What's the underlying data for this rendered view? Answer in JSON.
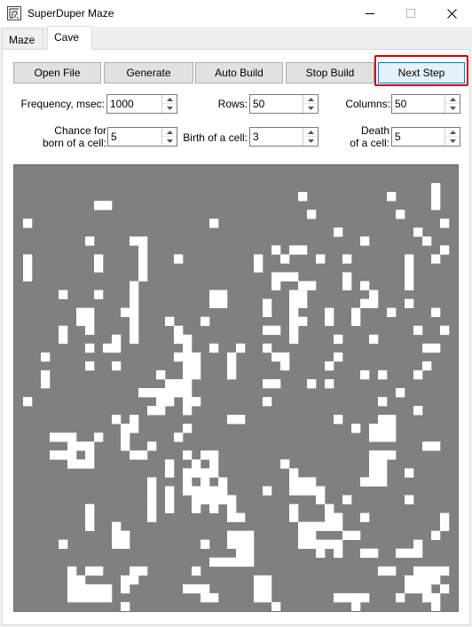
{
  "window": {
    "title": "SuperDuper Maze"
  },
  "tabs": [
    {
      "label": "Maze",
      "active": false
    },
    {
      "label": "Cave",
      "active": true
    }
  ],
  "toolbar": {
    "open_file": "Open File",
    "generate": "Generate",
    "auto_build": "Auto Build",
    "stop_build": "Stop Build",
    "next_step": "Next Step"
  },
  "settings": {
    "frequency": {
      "label": "Frequency, msec:",
      "value": "1000"
    },
    "rows": {
      "label": "Rows:",
      "value": "50"
    },
    "columns": {
      "label": "Columns:",
      "value": "50"
    },
    "chance": {
      "label_line1": "Chance for",
      "label_line2": "born of a cell:",
      "value": "5"
    },
    "birth": {
      "label": "Birth of a cell:",
      "value": "3"
    },
    "death": {
      "label_line1": "Death",
      "label_line2": "of a cell:",
      "value": "5"
    }
  },
  "icons": {
    "app": "maze-icon",
    "minimize": "minimize-icon",
    "maximize": "maximize-icon",
    "close": "close-icon",
    "spin_up": "chevron-up-icon",
    "spin_down": "chevron-down-icon"
  },
  "colors": {
    "wall": "#808080",
    "cell": "#ffffff",
    "highlight": "#d60000",
    "accent": "#0078d7"
  },
  "cave_grid": {
    "rows": 50,
    "columns": 50,
    "cells": [
      [
        2,
        47
      ],
      [
        3,
        32
      ],
      [
        3,
        42
      ],
      [
        3,
        47
      ],
      [
        4,
        9
      ],
      [
        4,
        10
      ],
      [
        4,
        47
      ],
      [
        5,
        33
      ],
      [
        5,
        43
      ],
      [
        6,
        1
      ],
      [
        6,
        22
      ],
      [
        6,
        48
      ],
      [
        7,
        36
      ],
      [
        7,
        45
      ],
      [
        8,
        8
      ],
      [
        8,
        13
      ],
      [
        8,
        14
      ],
      [
        8,
        39
      ],
      [
        8,
        46
      ],
      [
        9,
        14
      ],
      [
        9,
        29
      ],
      [
        9,
        31
      ],
      [
        9,
        32
      ],
      [
        9,
        48
      ],
      [
        10,
        1
      ],
      [
        10,
        9
      ],
      [
        10,
        14
      ],
      [
        10,
        18
      ],
      [
        10,
        27
      ],
      [
        10,
        30
      ],
      [
        10,
        34
      ],
      [
        10,
        37
      ],
      [
        10,
        44
      ],
      [
        10,
        47
      ],
      [
        11,
        1
      ],
      [
        11,
        9
      ],
      [
        11,
        14
      ],
      [
        11,
        27
      ],
      [
        11,
        44
      ],
      [
        12,
        1
      ],
      [
        12,
        14
      ],
      [
        12,
        29
      ],
      [
        12,
        30
      ],
      [
        12,
        31
      ],
      [
        12,
        37
      ],
      [
        12,
        44
      ],
      [
        13,
        13
      ],
      [
        13,
        29
      ],
      [
        13,
        32
      ],
      [
        13,
        33
      ],
      [
        13,
        37
      ],
      [
        13,
        39
      ],
      [
        13,
        44
      ],
      [
        14,
        5
      ],
      [
        14,
        9
      ],
      [
        14,
        13
      ],
      [
        14,
        22
      ],
      [
        14,
        23
      ],
      [
        14,
        31
      ],
      [
        14,
        32
      ],
      [
        14,
        40
      ],
      [
        15,
        13
      ],
      [
        15,
        22
      ],
      [
        15,
        23
      ],
      [
        15,
        28
      ],
      [
        15,
        31
      ],
      [
        15,
        32
      ],
      [
        15,
        39
      ],
      [
        15,
        40
      ],
      [
        15,
        44
      ],
      [
        16,
        7
      ],
      [
        16,
        8
      ],
      [
        16,
        12
      ],
      [
        16,
        13
      ],
      [
        16,
        28
      ],
      [
        16,
        31
      ],
      [
        16,
        35
      ],
      [
        16,
        38
      ],
      [
        16,
        42
      ],
      [
        16,
        47
      ],
      [
        17,
        7
      ],
      [
        17,
        8
      ],
      [
        17,
        13
      ],
      [
        17,
        17
      ],
      [
        17,
        21
      ],
      [
        17,
        31
      ],
      [
        17,
        32
      ],
      [
        17,
        35
      ],
      [
        17,
        38
      ],
      [
        18,
        8
      ],
      [
        18,
        5
      ],
      [
        18,
        13
      ],
      [
        18,
        18
      ],
      [
        18,
        28
      ],
      [
        18,
        29
      ],
      [
        18,
        31
      ],
      [
        18,
        48
      ],
      [
        18,
        45
      ],
      [
        19,
        5
      ],
      [
        19,
        11
      ],
      [
        19,
        13
      ],
      [
        19,
        18
      ],
      [
        19,
        19
      ],
      [
        19,
        31
      ],
      [
        19,
        36
      ],
      [
        19,
        40
      ],
      [
        20,
        8
      ],
      [
        20,
        10
      ],
      [
        20,
        11
      ],
      [
        20,
        19
      ],
      [
        20,
        22
      ],
      [
        20,
        25
      ],
      [
        20,
        28
      ],
      [
        20,
        46
      ],
      [
        20,
        47
      ],
      [
        21,
        3
      ],
      [
        21,
        18
      ],
      [
        21,
        19
      ],
      [
        21,
        20
      ],
      [
        21,
        24
      ],
      [
        21,
        29
      ],
      [
        21,
        30
      ],
      [
        21,
        36
      ],
      [
        22,
        8
      ],
      [
        22,
        11
      ],
      [
        22,
        19
      ],
      [
        22,
        20
      ],
      [
        22,
        24
      ],
      [
        22,
        35
      ],
      [
        22,
        30
      ],
      [
        22,
        46
      ],
      [
        23,
        3
      ],
      [
        23,
        16
      ],
      [
        23,
        19
      ],
      [
        23,
        20
      ],
      [
        23,
        24
      ],
      [
        23,
        39
      ],
      [
        23,
        41
      ],
      [
        23,
        45
      ],
      [
        24,
        3
      ],
      [
        24,
        17
      ],
      [
        24,
        18
      ],
      [
        24,
        19
      ],
      [
        24,
        28
      ],
      [
        24,
        29
      ],
      [
        24,
        33
      ],
      [
        24,
        35
      ],
      [
        25,
        14
      ],
      [
        25,
        15
      ],
      [
        25,
        16
      ],
      [
        25,
        17
      ],
      [
        25,
        18
      ],
      [
        25,
        19
      ],
      [
        25,
        43
      ],
      [
        26,
        1
      ],
      [
        26,
        16
      ],
      [
        26,
        17
      ],
      [
        26,
        19
      ],
      [
        26,
        20
      ],
      [
        26,
        28
      ],
      [
        26,
        41
      ],
      [
        27,
        15
      ],
      [
        27,
        16
      ],
      [
        27,
        19
      ],
      [
        27,
        45
      ],
      [
        28,
        11
      ],
      [
        28,
        13
      ],
      [
        28,
        24
      ],
      [
        28,
        25
      ],
      [
        28,
        36
      ],
      [
        28,
        41
      ],
      [
        28,
        42
      ],
      [
        29,
        12
      ],
      [
        29,
        13
      ],
      [
        29,
        19
      ],
      [
        29,
        38
      ],
      [
        29,
        40
      ],
      [
        29,
        41
      ],
      [
        29,
        42
      ],
      [
        30,
        4
      ],
      [
        30,
        5
      ],
      [
        30,
        6
      ],
      [
        30,
        9
      ],
      [
        30,
        12
      ],
      [
        30,
        18
      ],
      [
        30,
        40
      ],
      [
        30,
        41
      ],
      [
        30,
        42
      ],
      [
        31,
        6
      ],
      [
        31,
        7
      ],
      [
        31,
        8
      ],
      [
        31,
        12
      ],
      [
        31,
        15
      ],
      [
        31,
        46
      ],
      [
        31,
        47
      ],
      [
        32,
        4
      ],
      [
        32,
        5
      ],
      [
        32,
        6
      ],
      [
        32,
        8
      ],
      [
        32,
        13
      ],
      [
        32,
        14
      ],
      [
        32,
        19
      ],
      [
        32,
        21
      ],
      [
        32,
        22
      ],
      [
        32,
        40
      ],
      [
        32,
        41
      ],
      [
        32,
        42
      ],
      [
        33,
        6
      ],
      [
        33,
        7
      ],
      [
        33,
        8
      ],
      [
        33,
        17
      ],
      [
        33,
        20
      ],
      [
        33,
        22
      ],
      [
        33,
        30
      ],
      [
        33,
        40
      ],
      [
        33,
        41
      ],
      [
        34,
        17
      ],
      [
        34,
        19
      ],
      [
        34,
        20
      ],
      [
        34,
        21
      ],
      [
        34,
        22
      ],
      [
        34,
        31
      ],
      [
        34,
        40
      ],
      [
        34,
        41
      ],
      [
        34,
        44
      ],
      [
        35,
        15
      ],
      [
        35,
        19
      ],
      [
        35,
        21
      ],
      [
        35,
        23
      ],
      [
        35,
        31
      ],
      [
        35,
        32
      ],
      [
        35,
        33
      ],
      [
        35,
        39
      ],
      [
        35,
        40
      ],
      [
        35,
        41
      ],
      [
        36,
        15
      ],
      [
        36,
        17
      ],
      [
        36,
        19
      ],
      [
        36,
        20
      ],
      [
        36,
        21
      ],
      [
        36,
        22
      ],
      [
        36,
        23
      ],
      [
        36,
        28
      ],
      [
        36,
        31
      ],
      [
        36,
        32
      ],
      [
        36,
        33
      ],
      [
        36,
        34
      ],
      [
        37,
        15
      ],
      [
        37,
        17
      ],
      [
        37,
        20
      ],
      [
        37,
        21
      ],
      [
        37,
        22
      ],
      [
        37,
        23
      ],
      [
        37,
        24
      ],
      [
        37,
        34
      ],
      [
        37,
        37
      ],
      [
        37,
        44
      ],
      [
        38,
        8
      ],
      [
        38,
        15
      ],
      [
        38,
        17
      ],
      [
        38,
        20
      ],
      [
        38,
        22
      ],
      [
        38,
        24
      ],
      [
        38,
        31
      ],
      [
        38,
        35
      ],
      [
        39,
        8
      ],
      [
        39,
        15
      ],
      [
        39,
        24
      ],
      [
        39,
        25
      ],
      [
        39,
        31
      ],
      [
        39,
        35
      ],
      [
        39,
        36
      ],
      [
        39,
        39
      ],
      [
        39,
        48
      ],
      [
        40,
        8
      ],
      [
        40,
        11
      ],
      [
        40,
        32
      ],
      [
        40,
        33
      ],
      [
        40,
        34
      ],
      [
        40,
        35
      ],
      [
        40,
        36
      ],
      [
        40,
        48
      ],
      [
        41,
        11
      ],
      [
        41,
        12
      ],
      [
        41,
        24
      ],
      [
        41,
        25
      ],
      [
        41,
        26
      ],
      [
        41,
        32
      ],
      [
        41,
        33
      ],
      [
        41,
        37
      ],
      [
        41,
        38
      ],
      [
        41,
        47
      ],
      [
        42,
        5
      ],
      [
        42,
        11
      ],
      [
        42,
        12
      ],
      [
        42,
        21
      ],
      [
        42,
        24
      ],
      [
        42,
        25
      ],
      [
        42,
        26
      ],
      [
        42,
        32
      ],
      [
        42,
        33
      ],
      [
        42,
        34
      ],
      [
        42,
        35
      ],
      [
        42,
        36
      ],
      [
        42,
        45
      ],
      [
        43,
        25
      ],
      [
        43,
        26
      ],
      [
        43,
        34
      ],
      [
        43,
        36
      ],
      [
        43,
        39
      ],
      [
        43,
        40
      ],
      [
        43,
        43
      ],
      [
        43,
        44
      ],
      [
        43,
        45
      ],
      [
        44,
        22
      ],
      [
        44,
        23
      ],
      [
        44,
        24
      ],
      [
        44,
        25
      ],
      [
        44,
        26
      ],
      [
        45,
        6
      ],
      [
        45,
        8
      ],
      [
        45,
        9
      ],
      [
        45,
        13
      ],
      [
        45,
        14
      ],
      [
        45,
        20
      ],
      [
        45,
        41
      ],
      [
        45,
        42
      ],
      [
        45,
        45
      ],
      [
        45,
        46
      ],
      [
        45,
        47
      ],
      [
        45,
        48
      ],
      [
        46,
        6
      ],
      [
        46,
        7
      ],
      [
        46,
        12
      ],
      [
        46,
        13
      ],
      [
        46,
        27
      ],
      [
        46,
        28
      ],
      [
        46,
        44
      ],
      [
        46,
        45
      ],
      [
        46,
        46
      ],
      [
        46,
        47
      ],
      [
        47,
        6
      ],
      [
        47,
        7
      ],
      [
        47,
        8
      ],
      [
        47,
        9
      ],
      [
        47,
        10
      ],
      [
        47,
        12
      ],
      [
        47,
        19
      ],
      [
        47,
        20
      ],
      [
        47,
        21
      ],
      [
        47,
        27
      ],
      [
        47,
        28
      ],
      [
        47,
        44
      ],
      [
        47,
        45
      ],
      [
        47,
        46
      ],
      [
        47,
        48
      ],
      [
        48,
        6
      ],
      [
        48,
        7
      ],
      [
        48,
        8
      ],
      [
        48,
        9
      ],
      [
        48,
        10
      ],
      [
        48,
        21
      ],
      [
        48,
        22
      ],
      [
        48,
        27
      ],
      [
        48,
        28
      ],
      [
        48,
        36
      ],
      [
        48,
        37
      ],
      [
        48,
        38
      ],
      [
        48,
        39
      ],
      [
        48,
        43
      ],
      [
        48,
        46
      ],
      [
        48,
        47
      ],
      [
        49,
        12
      ],
      [
        49,
        29
      ],
      [
        49,
        38
      ],
      [
        49,
        47
      ]
    ]
  }
}
